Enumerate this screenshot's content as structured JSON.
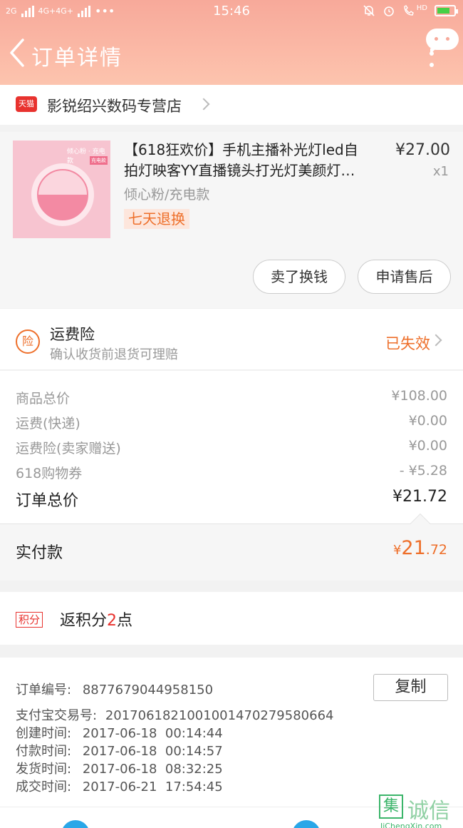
{
  "status_bar": {
    "network_left": "2G",
    "network_mid": "4G+4G+",
    "time": "15:46",
    "hd_label": "HD",
    "battery_level": 0.75
  },
  "header": {
    "title": "订单详情"
  },
  "shop": {
    "badge": "天猫",
    "name": "影锐绍兴数码专营店"
  },
  "product": {
    "thumb_caption": "倾心粉 · 充电款",
    "thumb_caption2": "充电款",
    "title_line1": "【618狂欢价】手机主播补光灯led自",
    "title_line2": "拍灯映客YY直播镜头打光灯美颜灯…",
    "price": "¥27.00",
    "quantity": "x1",
    "sku": "倾心粉/充电款",
    "tag": "七天退换",
    "btn_resell": "卖了换钱",
    "btn_after_sale": "申请售后"
  },
  "insurance": {
    "icon_text": "险",
    "title": "运费险",
    "subtitle": "确认收货前退货可理赔",
    "status": "已失效"
  },
  "summary": {
    "rows": [
      {
        "label": "商品总价",
        "value": "¥108.00"
      },
      {
        "label": "运费(快递)",
        "value": "¥0.00"
      },
      {
        "label": "运费险(卖家赠送)",
        "value": "¥0.00"
      },
      {
        "label": "618购物券",
        "value": "- ¥5.28"
      }
    ],
    "total_label": "订单总价",
    "total_value": "¥21.72"
  },
  "paid": {
    "label": "实付款",
    "currency": "¥",
    "int": "21",
    "dec": ".72"
  },
  "points": {
    "badge": "积分",
    "prefix": "返积分",
    "num": "2",
    "suffix": "点"
  },
  "info": {
    "order_no_label": "订单编号:",
    "order_no": "8877679044958150",
    "copy_label": "复制",
    "alipay_label": "支付宝交易号:",
    "alipay_no": "2017061821001001470279580664",
    "created_label": "创建时间:",
    "created": "2017-06-18  00:14:44",
    "paid_label": "付款时间:",
    "paid": "2017-06-18  00:14:57",
    "shipped_label": "发货时间:",
    "shipped": "2017-06-18  08:32:25",
    "closed_label": "成交时间:",
    "closed": "2017-06-21  17:54:45"
  },
  "watermark": {
    "box": "集",
    "text": "诚信",
    "site": "JiChengXin.com"
  }
}
